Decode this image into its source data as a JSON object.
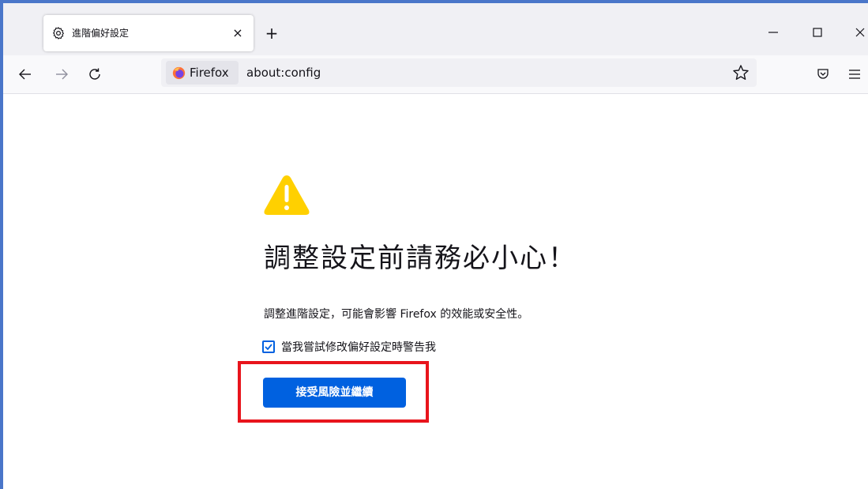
{
  "colors": {
    "frame": "#4a76c9",
    "accent": "#0061e0",
    "warning": "#ffd000",
    "highlight": "#e8141c"
  },
  "tab": {
    "icon": "gear-icon",
    "title": "進階偏好設定",
    "close_glyph": "×"
  },
  "new_tab_glyph": "+",
  "window_controls": {
    "minimize": "minimize-icon",
    "maximize": "maximize-icon",
    "close": "close-icon"
  },
  "navbar": {
    "back": "back-arrow-icon",
    "forward": "forward-arrow-icon",
    "reload": "reload-icon",
    "identity_label": "Firefox",
    "url": "about:config",
    "bookmark": "star-icon",
    "pocket": "pocket-icon",
    "menu": "hamburger-menu-icon"
  },
  "page": {
    "warning_icon": "warning-icon",
    "heading": "調整設定前請務必小心！",
    "description": "調整進階設定，可能會影響 Firefox 的效能或安全性。",
    "checkbox_label": "當我嘗試修改偏好設定時警告我",
    "checkbox_checked": true,
    "accept_button": "接受風險並繼續"
  }
}
